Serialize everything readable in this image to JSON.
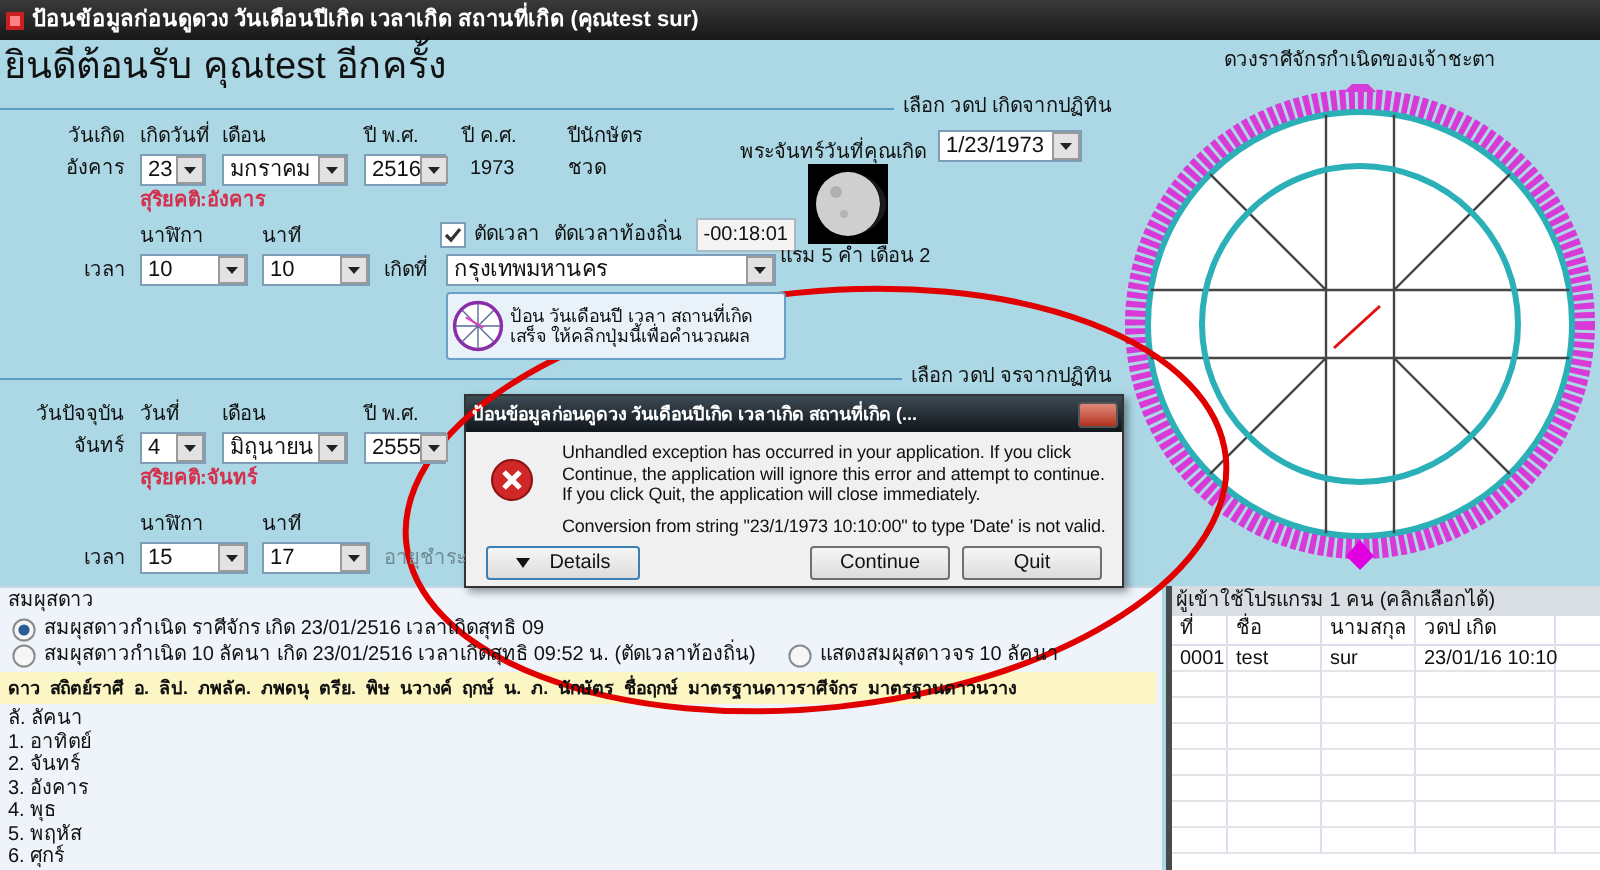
{
  "window": {
    "title": "ป้อนข้อมูลก่อนดูดวง วันเดือนปีเกิด เวลาเกิด สถานที่เกิด (คุณtest sur)"
  },
  "welcome": "ยินดีต้อนรับ คุณtest อีกครั้ง",
  "birth": {
    "section_label": "เลือก วดป เกิดจากปฏิทิน",
    "weekday_label": "วันเกิด",
    "weekday": "อังคาร",
    "day_label": "เกิดวันที่",
    "day": "23",
    "month_label": "เดือน",
    "month": "มกราคม",
    "year_label": "ปี พ.ศ.",
    "year": "2516",
    "ad_label": "ปี ค.ศ.",
    "ad_year": "1973",
    "zodiac_label": "ปีนักษัตร",
    "zodiac": "ชวด",
    "suriyakati": "สุริยคติ:อังคาร",
    "hour_label": "นาฬิกา",
    "hour": "10",
    "minute_label": "นาที",
    "minute": "10",
    "time_label": "เวลา",
    "cut_time": {
      "label": "ตัดเวลา",
      "checked": true
    },
    "local_label": "ตัดเวลาท้องถิ่น",
    "local_offset": "-00:18:01",
    "place_label": "เกิดที่",
    "place": "กรุงเทพมหานคร",
    "submit": "ป้อน วันเดือนปี เวลา สถานที่เกิด เสร็จ ให้คลิกปุ่มนี้เพื่อคำนวณผล",
    "moon_label": "พระจันทร์วันที่คุณเกิด",
    "calendar_date": "1/23/1973",
    "moon_phase": "แรม 5 ค่ำ เดือน 2"
  },
  "current": {
    "section_label": "เลือก วดป จรจากปฏิทิน",
    "weekday_label": "วันปัจจุบัน",
    "weekday": "จันทร์",
    "day_label": "วันที่",
    "day": "4",
    "month_label": "เดือน",
    "month": "มิถุนายน",
    "year_label": "ปี พ.ศ.",
    "year": "2555",
    "suriyakati": "สุริยคติ:จันทร์",
    "hour_label": "นาฬิกา",
    "hour": "15",
    "minute_label": "นาที",
    "minute": "17",
    "time_label": "เวลา",
    "age_label": "อายุชำระ"
  },
  "chart": {
    "title": "ดวงราศีจักรกำเนิดของเจ้าชะตา"
  },
  "planets": {
    "title": "สมผุสดาว",
    "options": [
      {
        "label": "สมผุสดาวกำเนิด ราศีจักร เกิด 23/01/2516 เวลาเกิดสุทธิ 09",
        "selected": true
      },
      {
        "label": "สมผุสดาวกำเนิด 10 ลัคนา เกิด 23/01/2516 เวลาเกิดสุทธิ 09:52 น. (ตัดเวลาท้องถิ่น)",
        "selected": false
      },
      {
        "label": "แสดงสมผุสดาวจร 10 ลัคนา",
        "selected": false
      }
    ],
    "columns": [
      "ดาว",
      "สถิตย์ราศี",
      "อ.",
      "ลิป.",
      "ภพลัค.",
      "ภพดนุ",
      "ตรีย.",
      "พิษ",
      "นวางค์",
      "ฤกษ์",
      "น.",
      "ภ.",
      "นักษัตร",
      "ชื่อฤกษ์",
      "มาตรฐานดาวราศีจักร",
      "มาตรฐานดาวนวาง"
    ],
    "rows": [
      "ลั. ลัคนา",
      "1. อาทิตย์",
      "2. จันทร์",
      "3. อังคาร",
      "4. พุธ",
      "5. พฤหัส",
      "6. ศุกร์"
    ]
  },
  "users": {
    "title": "ผู้เข้าใช้โปรแกรม 1 คน (คลิกเลือกได้)",
    "columns": [
      "ที่",
      "ชื่อ",
      "นามสกุล",
      "วดป เกิด"
    ],
    "rows": [
      [
        "0001",
        "test",
        "sur",
        "23/01/16 10:10"
      ]
    ]
  },
  "dialog": {
    "title": "ป้อนข้อมูลก่อนดูดวง วันเดือนปีเกิด เวลาเกิด สถานที่เกิด (...",
    "message": "Unhandled exception has occurred in your application. If you click Continue, the application will ignore this error and attempt to continue. If you click Quit, the application will close immediately.",
    "detail": "Conversion from string \"23/1/1973 10:10:00\" to type 'Date' is not valid.",
    "buttons": [
      {
        "label": "Details",
        "kind": "expander"
      },
      {
        "label": "Continue",
        "kind": "plain"
      },
      {
        "label": "Quit",
        "kind": "plain"
      }
    ]
  }
}
